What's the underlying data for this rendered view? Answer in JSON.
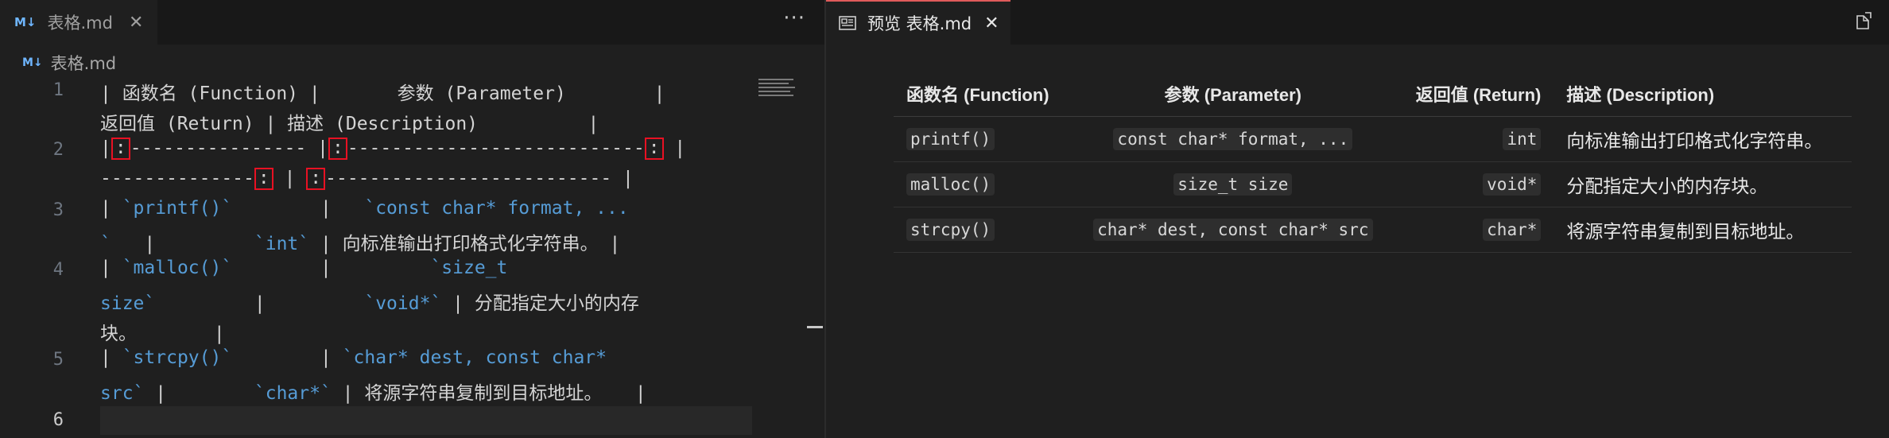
{
  "left_tab": {
    "icon": "M↓",
    "label": "表格.md",
    "close": "✕"
  },
  "more": "···",
  "breadcrumb": {
    "icon": "M↓",
    "file": "表格.md"
  },
  "lines": [
    {
      "num": "1",
      "parts": [
        {
          "text": "| 函数名 (Function) |       参数 (Parameter)        |"
        }
      ]
    },
    {
      "num": "",
      "parts": [
        {
          "text": "返回值 (Return) | 描述 (Description)          |"
        }
      ]
    },
    {
      "num": "2",
      "parts": [
        {
          "text": "|"
        },
        {
          "text": ":",
          "mark": true
        },
        {
          "text": "---------------- |"
        },
        {
          "text": ":",
          "mark": true
        },
        {
          "text": "---------------------------"
        },
        {
          "text": ":",
          "mark": true
        },
        {
          "text": " |"
        }
      ]
    },
    {
      "num": "",
      "parts": [
        {
          "text": "--------------"
        },
        {
          "text": ":",
          "mark": true
        },
        {
          "text": " | "
        },
        {
          "text": ":",
          "mark": true
        },
        {
          "text": "-------------------------- |"
        }
      ]
    },
    {
      "num": "3",
      "parts": [
        {
          "text": "| "
        },
        {
          "text": "`printf()`",
          "code": true
        },
        {
          "text": "        |   "
        },
        {
          "text": "`const char* format, ...",
          "code": true
        }
      ]
    },
    {
      "num": "",
      "parts": [
        {
          "text": "`",
          "code": true
        },
        {
          "text": "   |         "
        },
        {
          "text": "`int`",
          "code": true
        },
        {
          "text": " | 向标准输出打印格式化字符串。 |"
        }
      ]
    },
    {
      "num": "4",
      "parts": [
        {
          "text": "| "
        },
        {
          "text": "`malloc()`",
          "code": true
        },
        {
          "text": "        |         "
        },
        {
          "text": "`size_t",
          "code": true
        }
      ]
    },
    {
      "num": "",
      "parts": [
        {
          "text": "size`",
          "code": true
        },
        {
          "text": "         |         "
        },
        {
          "text": "`void*`",
          "code": true
        },
        {
          "text": " | 分配指定大小的内存"
        }
      ]
    },
    {
      "num": "",
      "parts": [
        {
          "text": "块。       |"
        }
      ]
    },
    {
      "num": "5",
      "parts": [
        {
          "text": "| "
        },
        {
          "text": "`strcpy()`",
          "code": true
        },
        {
          "text": "        | "
        },
        {
          "text": "`char* dest, const char*",
          "code": true
        }
      ]
    },
    {
      "num": "",
      "parts": [
        {
          "text": "src`",
          "code": true
        },
        {
          "text": " |        "
        },
        {
          "text": "`char*`",
          "code": true
        },
        {
          "text": " | 将源字符串复制到目标地址。   |"
        }
      ]
    },
    {
      "num": "6",
      "parts": []
    }
  ],
  "right_tab": {
    "label": "预览 表格.md",
    "close": "✕"
  },
  "table": {
    "headers": [
      "函数名 (Function)",
      "参数 (Parameter)",
      "返回值 (Return)",
      "描述 (Description)"
    ],
    "rows": [
      [
        "printf()",
        "const char* format, ...",
        "int",
        "向标准输出打印格式化字符串。"
      ],
      [
        "malloc()",
        "size_t size",
        "void*",
        "分配指定大小的内存块。"
      ],
      [
        "strcpy()",
        "char* dest, const char* src",
        "char*",
        "将源字符串复制到目标地址。"
      ]
    ]
  },
  "colors": {
    "accent_tab": "#e05b5b",
    "code": "#569cd6",
    "highlight_box": "#e81123",
    "md_icon": "#6fb6ff"
  }
}
